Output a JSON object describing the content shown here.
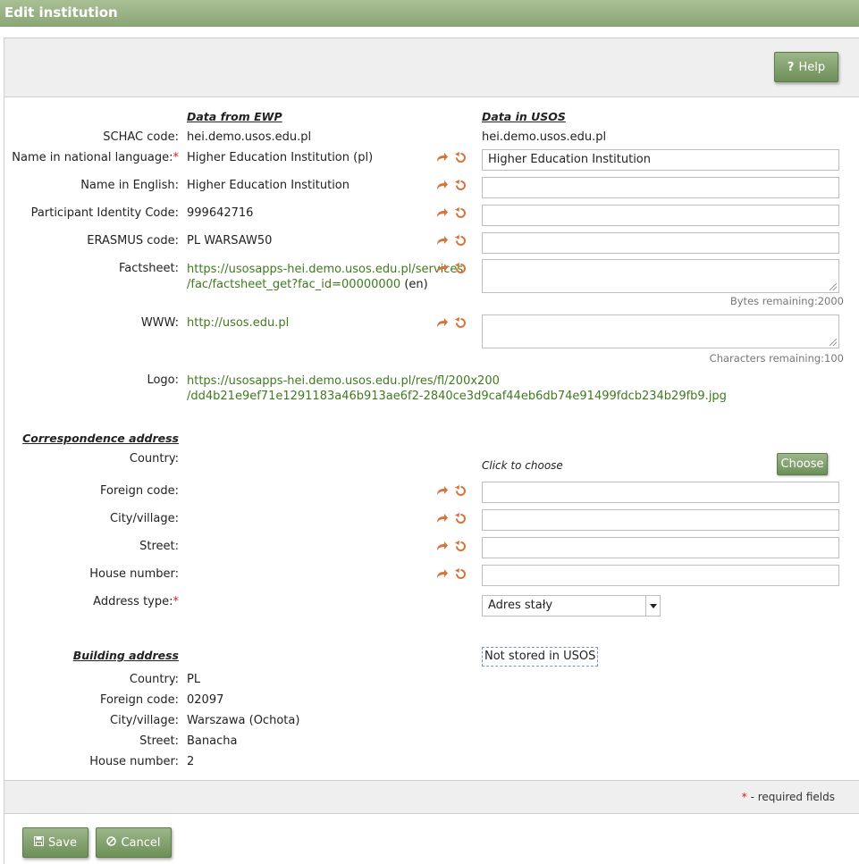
{
  "window": {
    "title": "Edit institution"
  },
  "toolbar": {
    "help_label": "Help",
    "help_icon": "?"
  },
  "columns": {
    "ewp_header": "Data from EWP",
    "usos_header": "Data in USOS"
  },
  "fields": {
    "schac": {
      "label": "SCHAC code:",
      "ewp": "hei.demo.usos.edu.pl",
      "usos": "hei.demo.usos.edu.pl"
    },
    "name_national": {
      "label": "Name in national language:",
      "required_mark": "*",
      "ewp": "Higher Education Institution (pl)",
      "usos": "Higher Education Institution"
    },
    "name_english": {
      "label": "Name in English:",
      "ewp": "Higher Education Institution",
      "usos": ""
    },
    "pic": {
      "label": "Participant Identity Code:",
      "ewp": "999642716",
      "usos": ""
    },
    "erasmus": {
      "label": "ERASMUS code:",
      "ewp": "PL WARSAW50",
      "usos": ""
    },
    "factsheet": {
      "label": "Factsheet:",
      "ewp_line1": "https://usosapps-hei.demo.usos.edu.pl/services",
      "ewp_line2": "/fac/factsheet_get?fac_id=00000000",
      "ewp_lang": " (en)",
      "usos": "",
      "remaining": "Bytes remaining:2000"
    },
    "www": {
      "label": "WWW:",
      "ewp": "http://usos.edu.pl",
      "usos": "",
      "remaining": "Characters remaining:100"
    },
    "logo": {
      "label": "Logo:",
      "ewp_line1": "https://usosapps-hei.demo.usos.edu.pl/res/fl/200x200",
      "ewp_line2": "/dd4b21e9ef71e1291183a46b913ae6f2-2840ce3d9caf44eb6db74e91499fdcb234b29fb9.jpg"
    }
  },
  "correspondence": {
    "header": "Correspondence address",
    "country": {
      "label": "Country:",
      "usos_hint": "Click to choose",
      "choose_label": "Choose"
    },
    "foreign_code": {
      "label": "Foreign code:",
      "usos": ""
    },
    "city": {
      "label": "City/village:",
      "usos": ""
    },
    "street": {
      "label": "Street:",
      "usos": ""
    },
    "house": {
      "label": "House number:",
      "usos": ""
    },
    "address_type": {
      "label": "Address type:",
      "required_mark": "*",
      "selected": "Adres stały"
    }
  },
  "building": {
    "header": "Building address",
    "not_stored": "Not stored in USOS",
    "country": {
      "label": "Country:",
      "value": "PL"
    },
    "foreign_code": {
      "label": "Foreign code:",
      "value": "02097"
    },
    "city": {
      "label": "City/village:",
      "value": "Warszawa (Ochota)"
    },
    "street": {
      "label": "Street:",
      "value": "Banacha"
    },
    "house": {
      "label": "House number:",
      "value": "2"
    }
  },
  "footer": {
    "required_star": "*",
    "required_note": " - required fields",
    "save_label": "Save",
    "cancel_label": "Cancel"
  },
  "colors": {
    "accent": "#7a9a65",
    "link": "#3f7a1f",
    "icon": "#d8743a",
    "required": "#d02020"
  }
}
